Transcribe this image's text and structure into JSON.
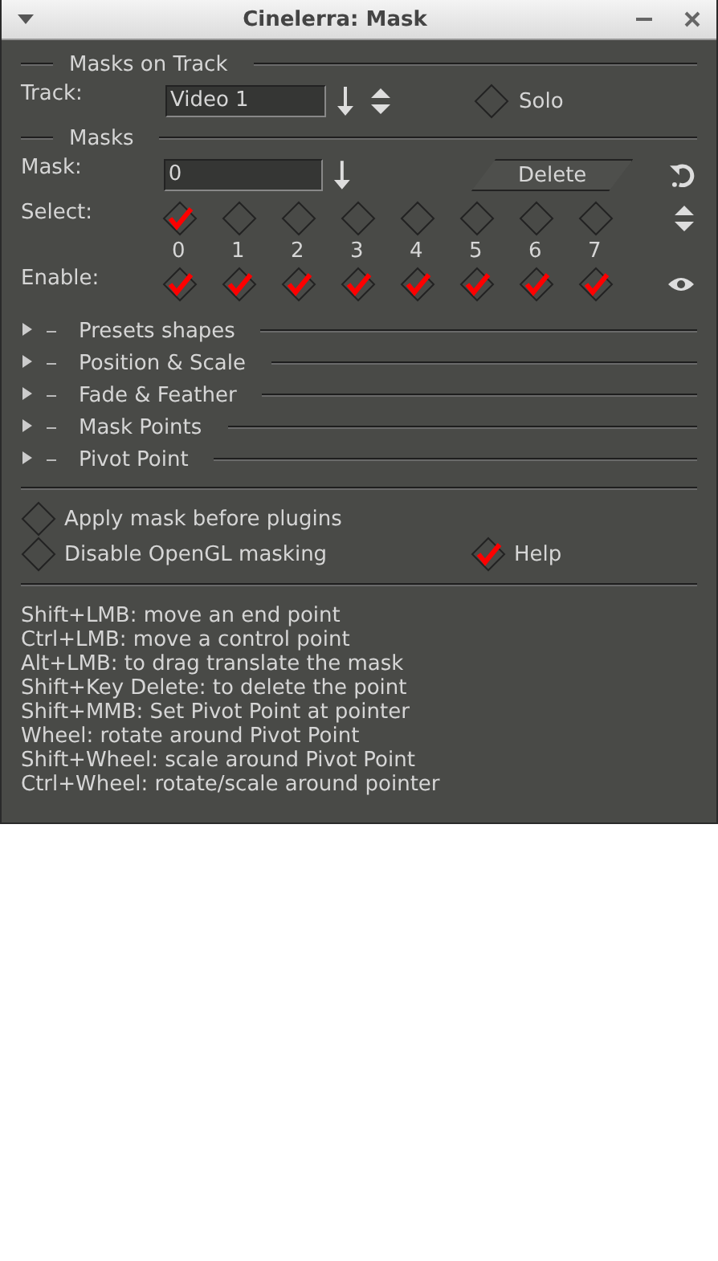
{
  "window": {
    "title": "Cinelerra: Mask"
  },
  "masks_on_track": {
    "heading": "Masks on Track",
    "track_label": "Track:",
    "track_value": "Video 1",
    "solo": {
      "label": "Solo",
      "checked": false
    }
  },
  "masks": {
    "heading": "Masks",
    "mask_label": "Mask:",
    "mask_value": "0",
    "delete_button": "Delete",
    "select_label": "Select:",
    "enable_label": "Enable:",
    "slots": [
      {
        "number": "0",
        "selected": true,
        "enabled": true
      },
      {
        "number": "1",
        "selected": false,
        "enabled": true
      },
      {
        "number": "2",
        "selected": false,
        "enabled": true
      },
      {
        "number": "3",
        "selected": false,
        "enabled": true
      },
      {
        "number": "4",
        "selected": false,
        "enabled": true
      },
      {
        "number": "5",
        "selected": false,
        "enabled": true
      },
      {
        "number": "6",
        "selected": false,
        "enabled": true
      },
      {
        "number": "7",
        "selected": false,
        "enabled": true
      }
    ]
  },
  "sections": [
    {
      "label": "Presets shapes",
      "expanded": false
    },
    {
      "label": "Position & Scale",
      "expanded": false
    },
    {
      "label": "Fade & Feather",
      "expanded": false
    },
    {
      "label": "Mask Points",
      "expanded": false
    },
    {
      "label": "Pivot Point",
      "expanded": false
    }
  ],
  "options": [
    {
      "label": "Apply mask before plugins",
      "checked": false
    },
    {
      "label": "Disable OpenGL masking",
      "checked": false
    }
  ],
  "help": {
    "label": "Help",
    "checked": true
  },
  "help_lines": [
    "Shift+LMB: move an end point",
    "Ctrl+LMB: move a control point",
    "Alt+LMB: to drag translate the mask",
    "Shift+Key Delete: to delete the point",
    "Shift+MMB: Set Pivot Point at pointer",
    "Wheel: rotate around Pivot Point",
    "Shift+Wheel: scale around Pivot Point",
    "Ctrl+Wheel: rotate/scale around pointer"
  ]
}
